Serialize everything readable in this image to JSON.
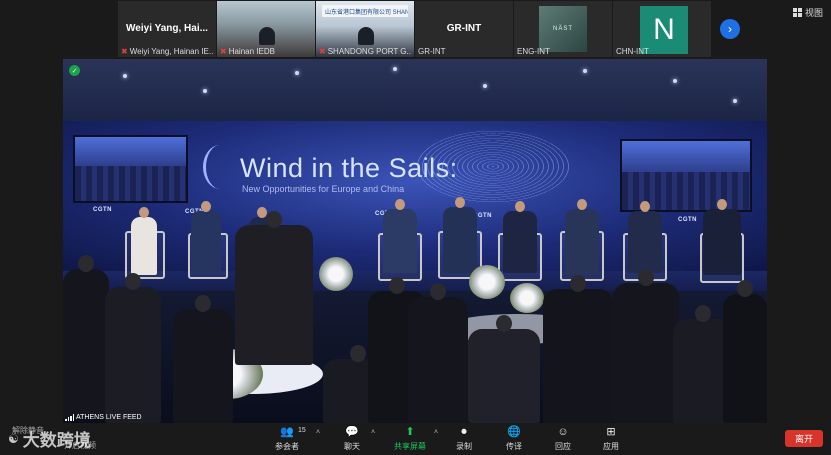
{
  "strip": {
    "tiles": [
      {
        "title": "Weiyi Yang, Hai...",
        "label": "Weiyi Yang, Hainan IE..."
      },
      {
        "label": "Hainan IEDB"
      },
      {
        "logo_text": "山东省港口集团有限公司 SHANDONG PORT GROUP CO.,LTD.",
        "label": "SHANDONG PORT G..."
      },
      {
        "title": "GR-INT",
        "label": "GR-INT"
      },
      {
        "image_text": "NÄST",
        "label": "ENG-INT"
      },
      {
        "avatar_letter": "N",
        "label": "CHN-INT"
      }
    ],
    "next_icon": "arrow-right-icon",
    "view_label": "视图"
  },
  "main": {
    "banner_title": "Wind in the Sails:",
    "banner_subtitle": "New Opportunities for Europe and China",
    "brand": "CGTN",
    "feed_label": "ATHENS LIVE FEED"
  },
  "toolbar": {
    "participant_count": "15",
    "items": [
      {
        "icon": "participants-icon",
        "label": "参会者"
      },
      {
        "icon": "chat-icon",
        "label": "聊天"
      },
      {
        "icon": "share-screen-icon",
        "label": "共享屏幕"
      },
      {
        "icon": "record-icon",
        "label": "录制"
      },
      {
        "icon": "translate-icon",
        "label": "传译"
      },
      {
        "icon": "reactions-icon",
        "label": "回应"
      },
      {
        "icon": "apps-icon",
        "label": "应用"
      }
    ],
    "leave_label": "离开",
    "left_labels": [
      "解除静音",
      "开启视频"
    ]
  },
  "watermark": "大数跨境",
  "colors": {
    "accent_green": "#22c55e",
    "leave_red": "#d9342b",
    "next_blue": "#1f6fe5",
    "avatar_teal": "#1a8b74"
  }
}
